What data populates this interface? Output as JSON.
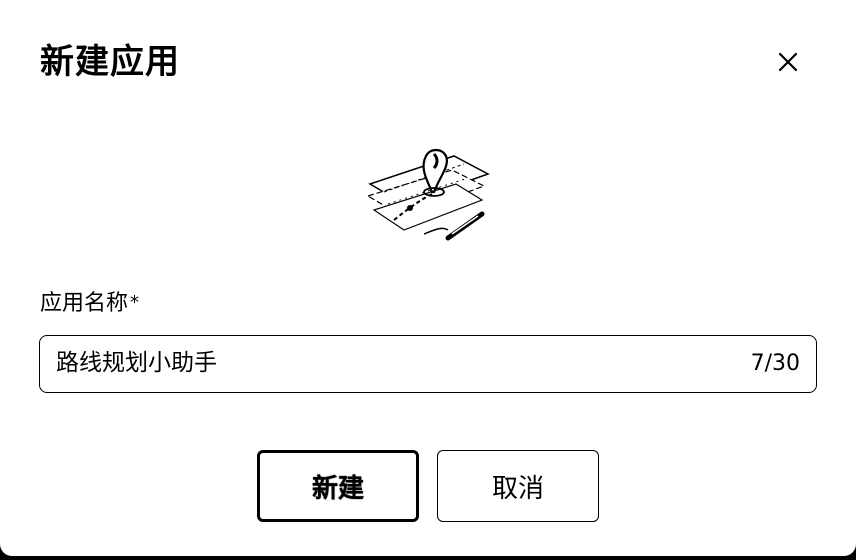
{
  "dialog": {
    "title": "新建应用",
    "close_icon": "close-icon",
    "illustration_icon": "route-map-illustration"
  },
  "form": {
    "name_label": "应用名称",
    "required_mark": "*",
    "name_value": "路线规划小助手",
    "char_counter": "7/30"
  },
  "buttons": {
    "create_label": "新建",
    "cancel_label": "取消"
  }
}
